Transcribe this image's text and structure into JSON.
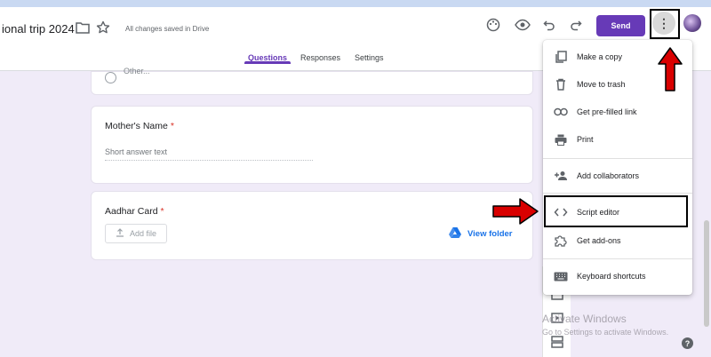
{
  "header": {
    "title": "ional trip 2024",
    "saved_status": "All changes saved in Drive",
    "send_label": "Send",
    "more_label": "⋮"
  },
  "tabs": [
    {
      "label": "Questions",
      "active": true
    },
    {
      "label": "Responses",
      "active": false
    },
    {
      "label": "Settings",
      "active": false
    }
  ],
  "form": {
    "top_option": "Other...",
    "questions": [
      {
        "label": "Mother's Name",
        "required": "*",
        "placeholder": "Short answer text"
      },
      {
        "label": "Aadhar Card",
        "required": "*",
        "add_file": "Add file",
        "view_folder": "View folder"
      }
    ]
  },
  "menu": {
    "items": [
      {
        "label": "Make a copy",
        "icon": "copy-icon"
      },
      {
        "label": "Move to trash",
        "icon": "trash-icon"
      },
      {
        "label": "Get pre-filled link",
        "icon": "link-icon"
      },
      {
        "label": "Print",
        "icon": "print-icon"
      },
      {
        "label": "Add collaborators",
        "icon": "add-person-icon"
      },
      {
        "label": "Script editor",
        "icon": "code-icon"
      },
      {
        "label": "Get add-ons",
        "icon": "puzzle-icon"
      },
      {
        "label": "Keyboard shortcuts",
        "icon": "keyboard-icon"
      }
    ]
  },
  "watermark": {
    "line1": "Activate Windows",
    "line2": "Go to Settings to activate Windows."
  },
  "colors": {
    "accent": "#673ab7",
    "background": "#f0ebf8",
    "annotation": "#d90000"
  }
}
